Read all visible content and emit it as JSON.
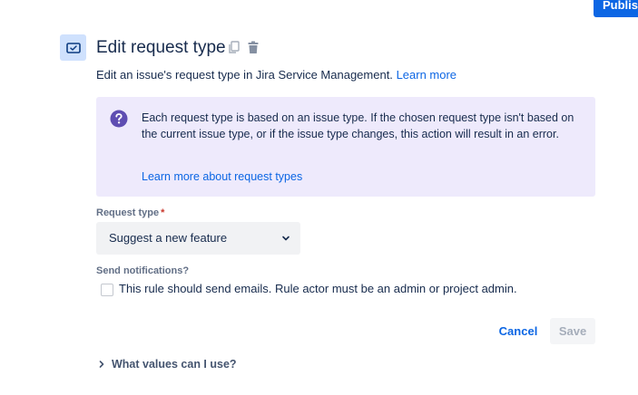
{
  "header": {
    "publish_label": "Publish"
  },
  "panel": {
    "title": "Edit request type",
    "icons": {
      "action": "checked-card-icon",
      "duplicate": "copy-icon",
      "delete": "trash-icon"
    },
    "description": "Edit an issue's request type in Jira Service Management.",
    "description_link": "Learn more",
    "info": {
      "icon": "question-circle-icon",
      "text": "Each request type is based on an issue type. If the chosen request type isn't based on the current issue type, or if the issue type changes, this action will result in an error.",
      "link": "Learn more about request types"
    },
    "request_type": {
      "label": "Request type",
      "required_marker": "*",
      "value": "Suggest a new feature"
    },
    "notifications": {
      "label": "Send notifications?",
      "checkbox_label": "This rule should send emails. Rule actor must be an admin or project admin."
    },
    "buttons": {
      "cancel": "Cancel",
      "save": "Save"
    },
    "help_expander": "What values can I use?"
  },
  "colors": {
    "brand": "#0c66e4",
    "info_bg": "#eeeafc",
    "info_icon": "#5e4db2",
    "required": "#c9372c"
  }
}
